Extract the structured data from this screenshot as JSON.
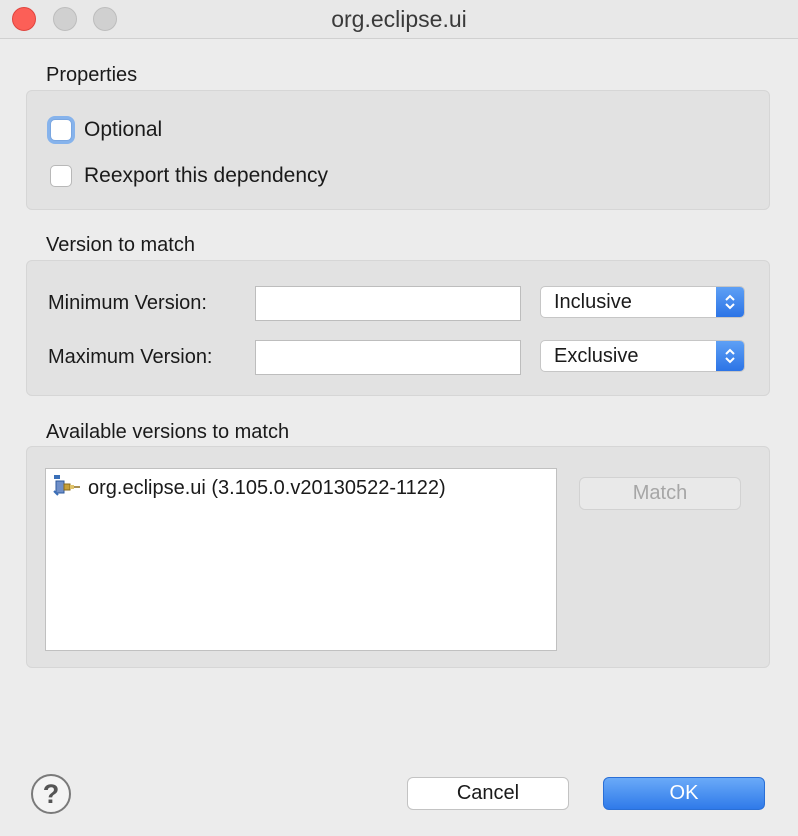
{
  "window": {
    "title": "org.eclipse.ui"
  },
  "properties": {
    "label": "Properties",
    "optional": {
      "label": "Optional",
      "checked": false
    },
    "reexport": {
      "label": "Reexport this dependency",
      "checked": false
    }
  },
  "version": {
    "label": "Version to match",
    "min": {
      "label": "Minimum Version:",
      "value": "",
      "bound": "Inclusive"
    },
    "max": {
      "label": "Maximum Version:",
      "value": "",
      "bound": "Exclusive"
    }
  },
  "available": {
    "label": "Available versions to match",
    "items": [
      {
        "label": "org.eclipse.ui (3.105.0.v20130522-1122)",
        "icon": "plugin-icon"
      }
    ],
    "match_label": "Match"
  },
  "footer": {
    "help_glyph": "?",
    "cancel_label": "Cancel",
    "ok_label": "OK"
  },
  "colors": {
    "accent": "#2f7ae9",
    "close": "#fc5f57"
  }
}
